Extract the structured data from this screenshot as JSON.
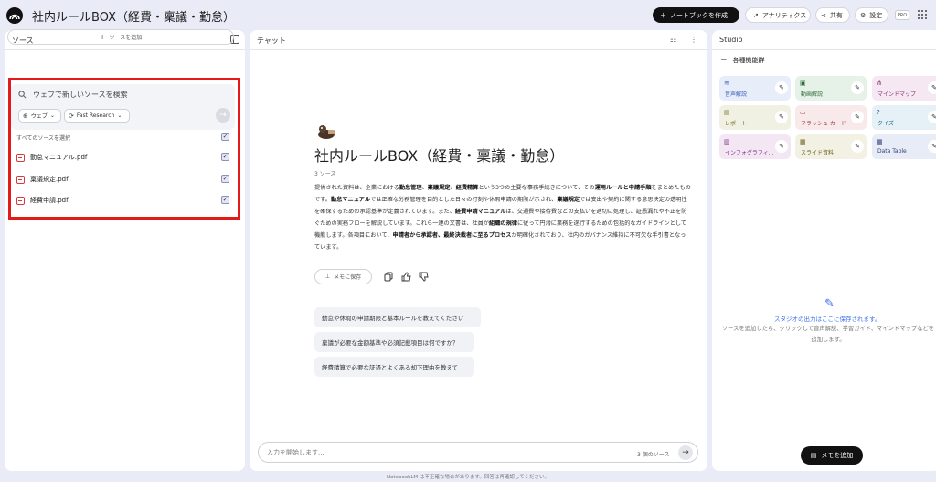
{
  "header": {
    "title": "社内ルールBOX（経費・稟議・勤怠）",
    "create_notebook": "ノートブックを作成",
    "analytics": "アナリティクス",
    "share": "共有",
    "settings": "設定",
    "pro_badge": "PRO"
  },
  "sources": {
    "panel_title": "ソース",
    "add_source": "ソースを追加",
    "search_placeholder": "ウェブで新しいソースを検索",
    "web_chip": "ウェブ",
    "research_chip": "Fast Research",
    "select_all": "すべてのソースを選択",
    "items": [
      {
        "name": "勤怠マニュアル.pdf",
        "checked": true
      },
      {
        "name": "稟議規定.pdf",
        "checked": true
      },
      {
        "name": "経費申請.pdf",
        "checked": true
      }
    ],
    "highlight_color": "#e21a1a"
  },
  "chat": {
    "panel_title": "チャット",
    "notebook_title": "社内ルールBOX（経費・稟議・勤怠）",
    "source_count": "3 ソース",
    "summary_segments": [
      {
        "t": "提供された資料は、企業における",
        "b": false
      },
      {
        "t": "勤怠管理",
        "b": true
      },
      {
        "t": "、",
        "b": false
      },
      {
        "t": "稟議規定",
        "b": true
      },
      {
        "t": "、",
        "b": false
      },
      {
        "t": "経費精算",
        "b": true
      },
      {
        "t": "という3つの主要な事務手続きについて、その",
        "b": false
      },
      {
        "t": "運用ルールと申請手順",
        "b": true
      },
      {
        "t": "をまとめたものです。",
        "b": false
      },
      {
        "t": "勤怠マニュアル",
        "b": true
      },
      {
        "t": "では正確な労務管理を目的とした日々の打刻や休暇申請の期限が示され、",
        "b": false
      },
      {
        "t": "稟議規定",
        "b": true
      },
      {
        "t": "では支出や契約に関する意思決定の透明性を確保するための承認基準が定義されています。また、",
        "b": false
      },
      {
        "t": "経費申請マニュアル",
        "b": true
      },
      {
        "t": "は、交通費や接待費などの支払いを適切に処理し、証憑漏れや不正を防ぐための実務フローを解説しています。これら一連の文書は、社員が",
        "b": false
      },
      {
        "t": "組織の規律",
        "b": true
      },
      {
        "t": "に従って円滑に業務を遂行するための包括的なガイドラインとして機能します。各項目において、",
        "b": false
      },
      {
        "t": "申請者から承認者、最終決裁者に至るプロセス",
        "b": true
      },
      {
        "t": "が明確化されており、社内のガバナンス維持に不可欠な手引書となっています。",
        "b": false
      }
    ],
    "save_memo": "メモに保存",
    "suggestions": [
      "勤怠や休暇の申請期限と基本ルールを教えてください",
      "稟議が必要な金額基準や必須記載項目は何ですか？",
      "経費精算で必要な証憑とよくある却下理由を教えて"
    ],
    "input_placeholder": "入力を開始します...",
    "input_source_count": "3 個のソース"
  },
  "studio": {
    "panel_title": "Studio",
    "section_title": "各種機能群",
    "tiles": [
      {
        "label": "音声解説",
        "icon": "audio-overview-icon",
        "bg": "#e8eef9",
        "fg": "#3b5bb5"
      },
      {
        "label": "動画解説",
        "icon": "video-overview-icon",
        "bg": "#e6f2e8",
        "fg": "#2e6a3b"
      },
      {
        "label": "マインドマップ",
        "icon": "mind-map-icon",
        "bg": "#f5e8f2",
        "fg": "#8a3a77"
      },
      {
        "label": "レポート",
        "icon": "report-icon",
        "bg": "#f1f1e3",
        "fg": "#6b6b2b"
      },
      {
        "label": "フラッシュ カード",
        "icon": "flashcard-icon",
        "bg": "#f8eaea",
        "fg": "#9a3636"
      },
      {
        "label": "クイズ",
        "icon": "quiz-icon",
        "bg": "#e5f1f7",
        "fg": "#246080"
      },
      {
        "label": "インフォグラフィ...",
        "icon": "infographic-icon",
        "bg": "#f3e7f3",
        "fg": "#80378a"
      },
      {
        "label": "スライド資料",
        "icon": "slides-icon",
        "bg": "#f2f1e3",
        "fg": "#6c6320"
      },
      {
        "label": "Data Table",
        "icon": "data-table-icon",
        "bg": "#e8ecf6",
        "fg": "#33407a"
      }
    ],
    "empty_title": "スタジオの出力はここに保存されます。",
    "empty_desc": "ソースを追加したら、クリックして音声解説、学習ガイド、マインドマップなどを追加します。",
    "add_memo": "メモを追加"
  },
  "footer": "NotebookLM は不正確な場合があります。回答は再確認してください。"
}
